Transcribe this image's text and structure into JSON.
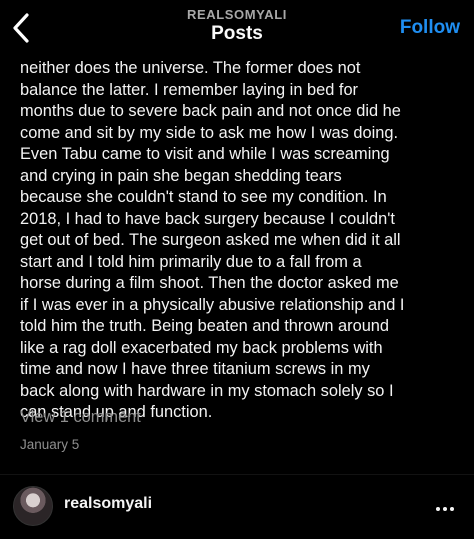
{
  "header": {
    "username": "REALSOMYALI",
    "title": "Posts",
    "follow_label": "Follow",
    "back_icon": "chevron-left-icon"
  },
  "post": {
    "caption": "neither does the universe. The former does not\nbalance the latter. I remember laying in bed for\nmonths due to severe back pain and not once did he\ncome and sit by my side to ask me how I was doing.\nEven Tabu came to visit and while I was screaming\nand crying in pain she began shedding tears\nbecause she couldn't stand to see my condition. In\n2018, I had to have back surgery because I couldn't\nget out of bed. The surgeon asked me when did it all\nstart and I told him primarily due to a fall from a\nhorse during a film shoot. Then the doctor asked me\nif I was ever in a physically abusive relationship and I\ntold him the truth. Being beaten and thrown around\nlike a rag doll exacerbated my back problems with\ntime and now I have three titanium screws in my\nback along with hardware in my stomach solely so I\ncan stand up and function.",
    "view_comments": "View 1 comment",
    "date": "January 5"
  },
  "author": {
    "username": "realsomyali",
    "more_icon": "more-options-icon"
  },
  "colors": {
    "background": "#000000",
    "accent": "#1f8ef1",
    "muted": "#8e8e8e"
  }
}
